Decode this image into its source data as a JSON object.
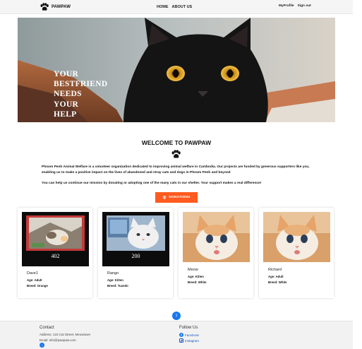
{
  "nav": {
    "brand": "PAWPAW",
    "links": [
      "HOME",
      "ABOUT US"
    ],
    "right_links": [
      "MyProfile",
      "Sign out"
    ]
  },
  "hero": {
    "lines": [
      "YOUR",
      "BESTFRIEND",
      "NEEDS",
      "YOUR",
      "HELP"
    ]
  },
  "welcome": {
    "title": "WELCOME TO PAWPAW",
    "para1": "Phnom Penh Animal Welfare is a volunteer organization dedicated to improving animal welfare in Cambodia. Our projects are funded by generous supporters like you, enabling us to make a positive impact on the lives of abandoned and stray cats and dogs in Phnom Penh and beyond",
    "para2": "You can help us continue our mission by donating or adopting one of the many cats in our shelter. Your support makes a real difference!",
    "donate_label": "DONATIONS"
  },
  "cats": [
    {
      "name": "Dave1",
      "age": "Age: Adult",
      "breed": "Breed: Orange",
      "photo_caption": "402"
    },
    {
      "name": "Rango",
      "age": "Age: Kitten",
      "breed": "Breed: Tuxedo",
      "photo_caption": "200"
    },
    {
      "name": "Meow",
      "age": "Age: Kitten",
      "breed": "Breed: White"
    },
    {
      "name": "Richard",
      "age": "Age: Adult",
      "breed": "Breed: White"
    }
  ],
  "pagination": {
    "current": "1"
  },
  "footer": {
    "contact_title": "Contact",
    "address": "Address: 123 Cat Street, Meowtown",
    "email": "Email: info@pawpaw.com",
    "follow_title": "Follow Us",
    "facebook": "Facebook",
    "instagram": "Instagram"
  },
  "colors": {
    "accent": "#ff5a1f",
    "link": "#1877f2"
  },
  "icons": [
    "paw-icon",
    "facebook-icon",
    "instagram-icon",
    "arrow-up-icon"
  ]
}
